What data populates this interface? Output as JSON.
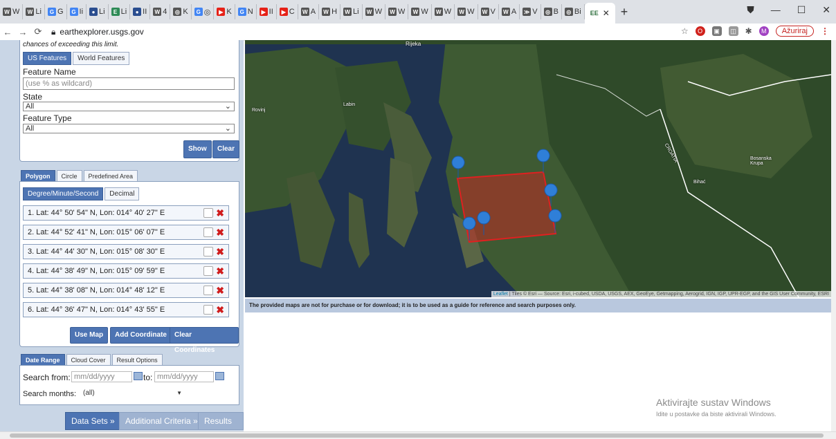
{
  "browser": {
    "tabs": [
      {
        "icon": "W",
        "label": "W",
        "color": "#555"
      },
      {
        "icon": "W",
        "label": "Li",
        "color": "#555"
      },
      {
        "icon": "G",
        "label": "G",
        "color": "#4285f4"
      },
      {
        "icon": "G",
        "label": "Ii",
        "color": "#4285f4"
      },
      {
        "icon": "●",
        "label": "Li",
        "color": "#2a4d8f"
      },
      {
        "icon": "E",
        "label": "Li",
        "color": "#2e8b57"
      },
      {
        "icon": "●",
        "label": "II",
        "color": "#2a4d8f"
      },
      {
        "icon": "W",
        "label": "4",
        "color": "#555"
      },
      {
        "icon": "◎",
        "label": "K",
        "color": "#555"
      },
      {
        "icon": "G",
        "label": "◎",
        "color": "#4285f4"
      },
      {
        "icon": "▶",
        "label": "K",
        "color": "#e62117"
      },
      {
        "icon": "G",
        "label": "N",
        "color": "#4285f4"
      },
      {
        "icon": "▶",
        "label": "II",
        "color": "#e62117"
      },
      {
        "icon": "▶",
        "label": "C",
        "color": "#e62117"
      },
      {
        "icon": "W",
        "label": "A",
        "color": "#555"
      },
      {
        "icon": "W",
        "label": "H",
        "color": "#555"
      },
      {
        "icon": "W",
        "label": "Li",
        "color": "#555"
      },
      {
        "icon": "W",
        "label": "W",
        "color": "#555"
      },
      {
        "icon": "W",
        "label": "W",
        "color": "#555"
      },
      {
        "icon": "W",
        "label": "W",
        "color": "#555"
      },
      {
        "icon": "W",
        "label": "W",
        "color": "#555"
      },
      {
        "icon": "W",
        "label": "W",
        "color": "#555"
      },
      {
        "icon": "W",
        "label": "V",
        "color": "#555"
      },
      {
        "icon": "W",
        "label": "A",
        "color": "#555"
      },
      {
        "icon": "≫",
        "label": "V",
        "color": "#555"
      },
      {
        "icon": "◎",
        "label": "B",
        "color": "#555"
      },
      {
        "icon": "◎",
        "label": "Bi",
        "color": "#555"
      }
    ],
    "active_tab": {
      "icon": "EE",
      "label": ""
    },
    "new_tab": "+",
    "url": "earthexplorer.usgs.gov",
    "update_label": "Ažuriraj",
    "profile_initial": "M"
  },
  "sidebar": {
    "limit_text": "chances of exceeding this limit.",
    "feature_tabs": [
      "US Features",
      "World Features"
    ],
    "feature_name_label": "Feature Name",
    "feature_name_placeholder": "(use % as wildcard)",
    "state_label": "State",
    "state_value": "All",
    "feature_type_label": "Feature Type",
    "feature_type_value": "All",
    "show_label": "Show",
    "clear_label": "Clear",
    "area_tabs": [
      "Polygon",
      "Circle",
      "Predefined Area"
    ],
    "coord_tabs": [
      "Degree/Minute/Second",
      "Decimal"
    ],
    "coordinates": [
      "1. Lat: 44° 50' 54\" N, Lon: 014° 40' 27\" E",
      "2. Lat: 44° 52' 41\" N, Lon: 015° 06' 07\" E",
      "3. Lat: 44° 44' 30\" N, Lon: 015° 08' 30\" E",
      "4. Lat: 44° 38' 49\" N, Lon: 015° 09' 59\" E",
      "5. Lat: 44° 38' 08\" N, Lon: 014° 48' 12\" E",
      "6. Lat: 44° 36' 47\" N, Lon: 014° 43' 55\" E"
    ],
    "use_map_label": "Use Map",
    "add_coord_label": "Add Coordinate",
    "clear_coords_label": "Clear Coordinates",
    "date_tabs": [
      "Date Range",
      "Cloud Cover",
      "Result Options"
    ],
    "search_from_label": "Search from:",
    "date_placeholder": "mm/dd/yyyy",
    "to_label": "to:",
    "search_months_label": "Search months:",
    "search_months_value": "(all)",
    "nav_buttons": [
      "Data Sets »",
      "Additional Criteria »",
      "Results »"
    ]
  },
  "map": {
    "labels": [
      "Rijeka",
      "Rovinj",
      "Labin",
      "CROATIA",
      "Bihać",
      "Bosanska Krupa"
    ],
    "attribution_link": "Leaflet",
    "attribution_text": "| Tiles © Esri — Source: Esri, i-cubed, USDA, USGS, AEX, GeoEye, Getmapping, Aerogrid, IGN, IGP, UPR-EGP, and the GIS User Community, ESRI",
    "notice": "The provided maps are not for purchase or for download; it is to be used as a guide for reference and search purposes only."
  },
  "watermark": {
    "line1": "Aktivirajte sustav Windows",
    "line2": "Idite u postavke da biste aktivirali Windows."
  }
}
